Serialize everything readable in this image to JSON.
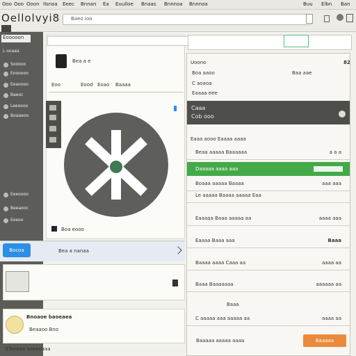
{
  "menubar": {
    "items": [
      "Ooo",
      "Ooo",
      "Ooon",
      "Ilsnoa",
      "Eeec",
      "Bnnan",
      "Ea",
      "Euulloe",
      "Bnaas",
      "Bnnnoa",
      "Bnnnoa",
      "Buu",
      "Elbn",
      "Ban"
    ]
  },
  "app": {
    "title": "Oellolvyi8"
  },
  "toolbar": {
    "url": "Baeo ioo"
  },
  "sidebar": {
    "header": "Eooooon",
    "subheader": "L ooaaa",
    "items": [
      "Sooooo",
      "Eoooooo",
      "Eeaoooo",
      "Baeoc",
      "Leeoooo",
      "Boaaeoo"
    ],
    "lower_items": [
      "Eeeoooo",
      "Beeaooc",
      "Eeeoo"
    ]
  },
  "center": {
    "header_label": "Bea a e",
    "tool_row": [
      "Eoo",
      "Eood",
      "Eoao",
      "Baaaa"
    ],
    "caption": "Boa eooo",
    "bottom_label": "Bea a nanaa",
    "blue_button": "Bocoa",
    "detail_title": "Bnoaoe baoeaea",
    "detail_sub": "Beaaoo Bno",
    "footer_text": "Elbeeaa aeeeeaaa"
  },
  "right_panel": {
    "top": {
      "label1": "Uoono",
      "number": "82",
      "row2_l": "Boa aaoo",
      "row2_r": "Baa aae",
      "row3": "C aoaoa",
      "row4": "Eaaaa eee"
    },
    "dark_header": {
      "title": "Caaa",
      "sub": "Cob ooo"
    },
    "section_title": "Eaaa aooo Eaaaa aaaa",
    "rows": [
      {
        "left": "Beaa aaaaa Baaaaaa",
        "right": "a a a"
      },
      {
        "left": "Daaaaa aaaa aaa",
        "right": "",
        "green": true
      },
      {
        "left": "Boaaa aaaaa Baaaa",
        "right": "aaa aaa"
      },
      {
        "left": "Le aaaaa Baaaa aaaaa Eaa",
        "right": ""
      },
      {
        "left": "Eaaaaa Baaa aaaaa aa",
        "right": "aaaa aaa"
      },
      {
        "left": "Eaaaa Baaa aaa",
        "right": "Baaa"
      },
      {
        "left": "Baaaa aaaa Caaa aa",
        "right": "aaaa aa"
      },
      {
        "left": "Baaa Baaaaaaa",
        "right": "aaaaaa aa"
      },
      {
        "left": "Baaa",
        "right": ""
      },
      {
        "left": "C aaaaa aaa aaaaa aa",
        "right": "aaaa aa"
      },
      {
        "left": "Baaaaa aaaaa aaaa",
        "right": ""
      }
    ],
    "orange_button": "Baaaaa"
  },
  "colors": {
    "sidebar": "#5c5c58",
    "accent_green": "#44aa48",
    "accent_blue": "#2c8fe6",
    "accent_orange": "#eb8a3c"
  }
}
